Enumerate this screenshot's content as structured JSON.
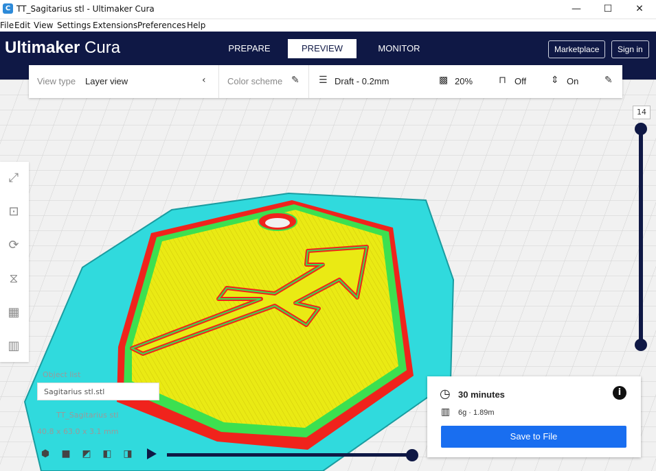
{
  "window": {
    "title": "TT_Sagitarius stl - Ultimaker Cura",
    "minimize": "—",
    "maximize": "☐",
    "close": "✕"
  },
  "menu": [
    "File",
    "Edit",
    "View",
    "Settings",
    "Extensions",
    "Preferences",
    "Help"
  ],
  "header": {
    "brand_bold": "Ultimaker",
    "brand_light": " Cura",
    "tabs": [
      "PREPARE",
      "PREVIEW",
      "MONITOR"
    ],
    "active_tab": "PREVIEW",
    "marketplace": "Marketplace",
    "sign_in": "Sign in"
  },
  "view_toolbar": {
    "view_type_label": "View type",
    "view_type_value": "Layer view",
    "color_scheme_label": "Color scheme",
    "profile": "Draft - 0.2mm",
    "infill": "20%",
    "support": "Off",
    "adhesion": "On"
  },
  "layer_slider": {
    "layer": "14"
  },
  "object": {
    "name": "Sagitarius stl.stl",
    "list_label": "Object list",
    "file_label": "TT_Sagitarius stl",
    "dimensions": "40.8 x 63.0 x 3.1 mm"
  },
  "print_panel": {
    "time": "30 minutes",
    "material": "6g · 1.89m",
    "save_button": "Save to File"
  },
  "colors": {
    "header": "#0f1845",
    "accent": "#196ef0",
    "skirt": "#30dadd",
    "wall": "#f0231c",
    "top": "#eaea14",
    "inner": "#3ce050"
  }
}
